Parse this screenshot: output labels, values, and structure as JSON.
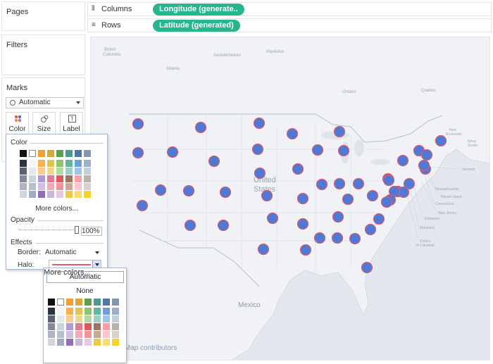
{
  "left_panel": {
    "pages": "Pages",
    "filters": "Filters",
    "marks": "Marks",
    "mark_type": "Automatic",
    "buttons": [
      {
        "label": "Color",
        "icon": "color-dots-icon"
      },
      {
        "label": "Size",
        "icon": "size-icon"
      },
      {
        "label": "Label",
        "icon": "label-T-icon"
      }
    ]
  },
  "shelves": {
    "columns_label": "Columns",
    "columns_pill": "Longitude (generate..",
    "rows_label": "Rows",
    "rows_pill": "Latitude (generated)"
  },
  "color_popup": {
    "title": "Color",
    "more_colors": "More colors...",
    "opacity_label": "Opacity",
    "opacity_value": "100%",
    "opacity_fraction": 1.0,
    "effects_label": "Effects",
    "border_label": "Border:",
    "border_value": "Automatic",
    "halo_label": "Halo:",
    "halo_color": "#e05a6a"
  },
  "halo_popup": {
    "automatic": "Automatic",
    "none": "None",
    "more_colors": "More colors..."
  },
  "map": {
    "labels": {
      "country": "United\nStates",
      "us1": "United",
      "us2": "States",
      "mexico": "Mexico",
      "british_columbia": "British\nColumbia",
      "bc1": "British",
      "bc2": "Columbia",
      "alberta": "Alberta",
      "saskatchewan": "Saskatchewan",
      "manitoba": "Manitoba",
      "ontario": "Ontario",
      "quebec": "Quebec",
      "new_brunswick": "New\nBrunswick",
      "nb1": "New",
      "nb2": "Brunswick",
      "nova_scotia": "Nova\nScotia",
      "ns1": "Nova",
      "ns2": "Scotia",
      "vermont": "Vermont",
      "massachusetts": "Massachusetts",
      "rhode_island": "Rhode Island",
      "connecticut": "Connecticut",
      "new_jersey": "New Jersey",
      "delaware": "Delaware",
      "maryland": "Maryland",
      "dc": "District\nof Columbia",
      "dc1": "District",
      "dc2": "of Columbia"
    },
    "attribution": "tMap contributors",
    "mark_color": "#4e79d6",
    "halo_color": "#e05a6a",
    "land_color": "#f0f1f4",
    "water_color": "#e2e6ec"
  },
  "palette": {
    "top_row": [
      "#111111",
      "#ffffff",
      "#f0a030",
      "#d7a73a",
      "#59a14f",
      "#4e9a8b",
      "#4e79a7",
      "#8497b0"
    ],
    "grid": [
      [
        "#2b3240",
        "#f5f5f5",
        "#fbb04e",
        "#e1c255",
        "#8cc471",
        "#63b59e",
        "#6c9fd6",
        "#9fb0c6"
      ],
      [
        "#5a6272",
        "#e3e8ef",
        "#fdcb8d",
        "#edd891",
        "#b3daa1",
        "#9cd1c1",
        "#a3c4ea",
        "#c4cfdc"
      ],
      [
        "#838b9a",
        "#cbd3de",
        "#b39ad1",
        "#e17b8f",
        "#e15759",
        "#9c755f",
        "#ff9da7",
        "#bab0ac"
      ],
      [
        "#adb4c0",
        "#b5bfcd",
        "#d0bfe3",
        "#f0aab7",
        "#f29496",
        "#c7a996",
        "#ffc5cc",
        "#d7d0cc"
      ],
      [
        "#d0d5dd",
        "#a1adbe",
        "#8e6fb8",
        "#c7b8d8",
        "#e3c9e1",
        "#edc948",
        "#f7dc6f",
        "#f6d32a"
      ]
    ]
  }
}
